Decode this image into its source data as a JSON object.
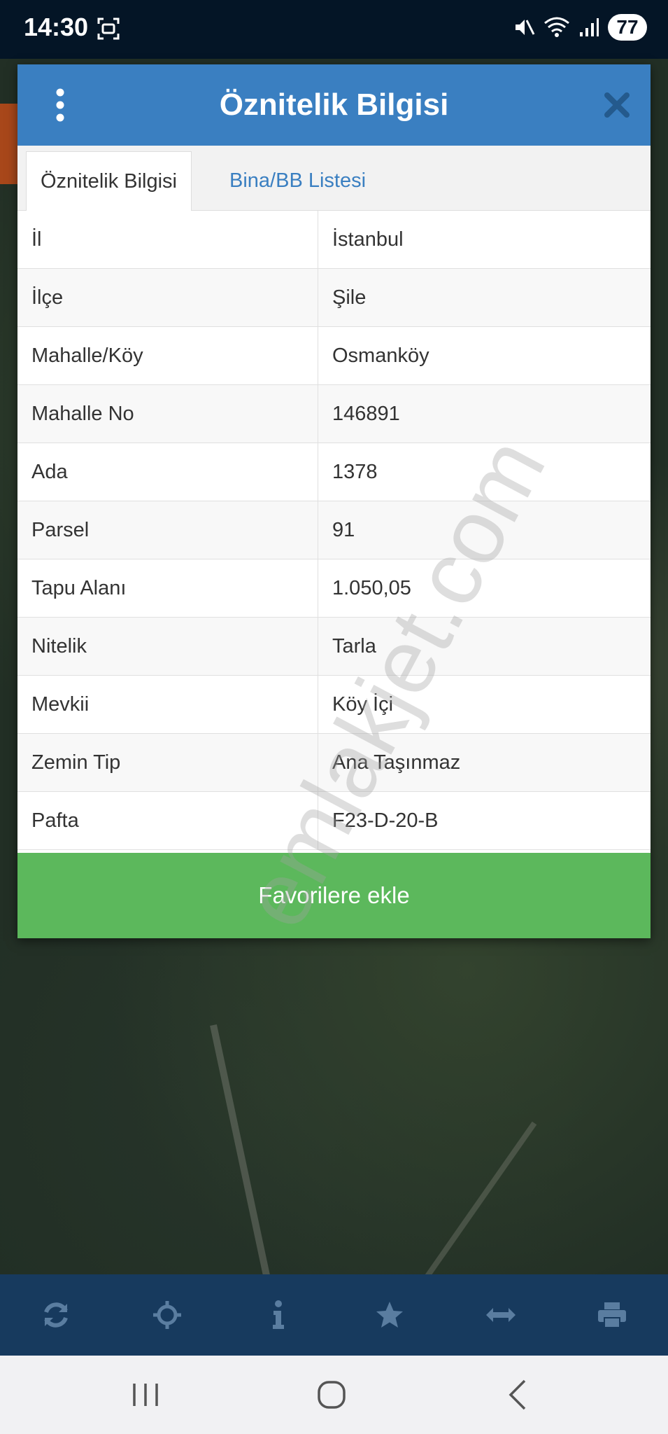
{
  "status_bar": {
    "time": "14:30",
    "battery": "77",
    "icons": [
      "screenshot-icon",
      "mute-icon",
      "wifi-icon",
      "signal-icon"
    ]
  },
  "dialog": {
    "title": "Öznitelik Bilgisi",
    "menu_icon": "vertical-dots-icon",
    "close_icon": "close-icon",
    "tabs": [
      {
        "label": "Öznitelik Bilgisi",
        "active": true
      },
      {
        "label": "Bina/BB Listesi",
        "active": false
      }
    ],
    "rows": [
      {
        "key": "İl",
        "value": "İstanbul"
      },
      {
        "key": "İlçe",
        "value": "Şile"
      },
      {
        "key": "Mahalle/Köy",
        "value": "Osmanköy"
      },
      {
        "key": "Mahalle No",
        "value": "146891"
      },
      {
        "key": "Ada",
        "value": "1378"
      },
      {
        "key": "Parsel",
        "value": "91"
      },
      {
        "key": "Tapu Alanı",
        "value": "1.050,05"
      },
      {
        "key": "Nitelik",
        "value": "Tarla"
      },
      {
        "key": "Mevkii",
        "value": "Köy İçi"
      },
      {
        "key": "Zemin Tip",
        "value": "Ana Taşınmaz"
      },
      {
        "key": "Pafta",
        "value": "F23-D-20-B"
      }
    ],
    "favorite_button": "Favorilere ekle"
  },
  "watermark": "emlakjet.com",
  "toolbar": {
    "icons": [
      "refresh-icon",
      "crosshair-icon",
      "info-icon",
      "star-icon",
      "measure-icon",
      "print-icon"
    ]
  },
  "navbar": {
    "icons": [
      "recent-apps-icon",
      "home-icon",
      "back-icon"
    ]
  },
  "colors": {
    "header": "#3a7fc1",
    "favorite": "#5cb85c",
    "toolbar": "#173a5e",
    "status_bar": "#041526"
  }
}
